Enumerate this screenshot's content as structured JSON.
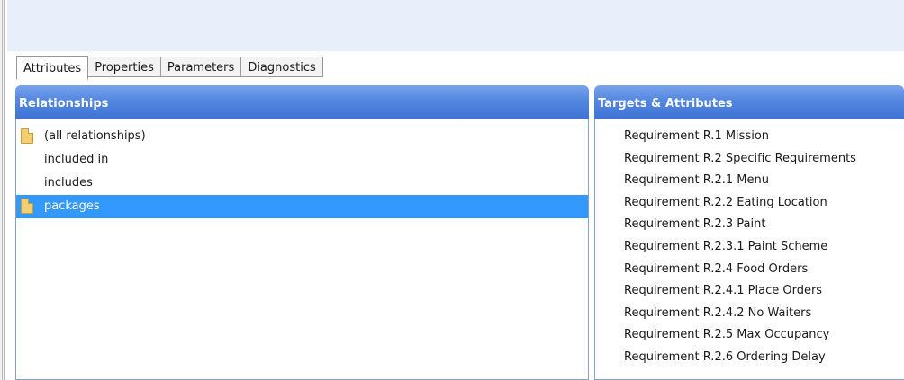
{
  "tabs": [
    {
      "label": "Attributes",
      "active": true
    },
    {
      "label": "Properties",
      "active": false
    },
    {
      "label": "Parameters",
      "active": false
    },
    {
      "label": "Diagnostics",
      "active": false
    }
  ],
  "relationships": {
    "title": "Relationships",
    "items": [
      {
        "label": "(all relationships)",
        "icon": "folder-icon"
      },
      {
        "label": "included in",
        "icon": ""
      },
      {
        "label": "includes",
        "icon": ""
      },
      {
        "label": "packages",
        "icon": "folder-icon",
        "selected": true
      }
    ]
  },
  "targets": {
    "title": "Targets & Attributes",
    "items": [
      "Requirement R.1 Mission",
      "Requirement R.2 Specific Requirements",
      "Requirement R.2.1 Menu",
      "Requirement R.2.2 Eating Location",
      "Requirement R.2.3 Paint",
      "Requirement R.2.3.1 Paint Scheme",
      "Requirement R.2.4 Food Orders",
      "Requirement R.2.4.1 Place Orders",
      "Requirement R.2.4.2 No Waiters",
      "Requirement R.2.5 Max Occupancy",
      "Requirement R.2.6 Ordering Delay"
    ]
  },
  "colors": {
    "header_gradient_top": "#79a4ec",
    "header_gradient_bottom": "#3f74d6",
    "selection": "#3399ff",
    "top_band": "#e8eefa"
  }
}
